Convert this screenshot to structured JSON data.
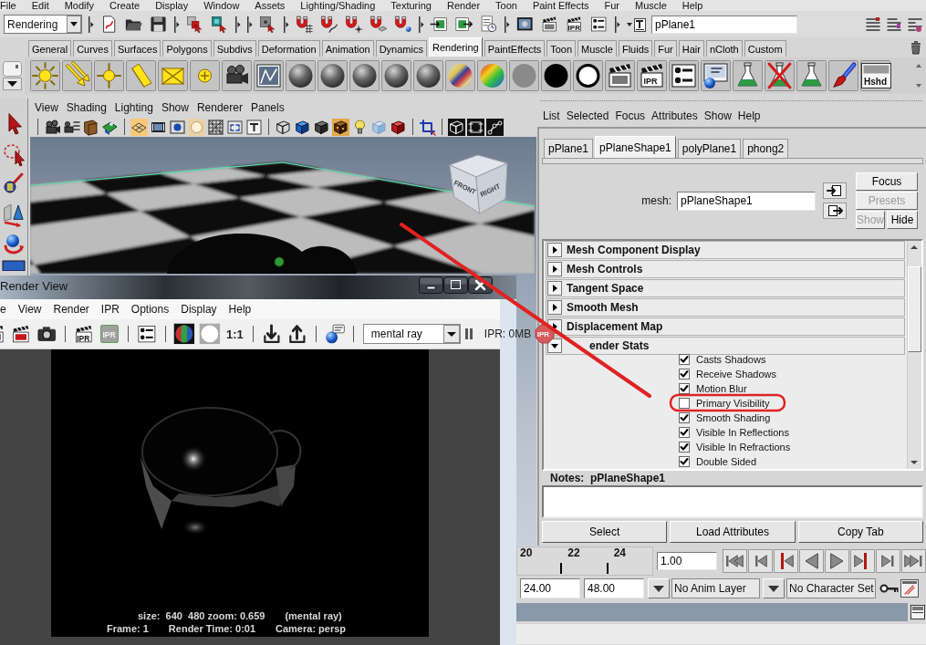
{
  "menu_bar": [
    "File",
    "Edit",
    "Modify",
    "Create",
    "Display",
    "Window",
    "Assets",
    "Lighting/Shading",
    "Texturing",
    "Render",
    "Toon",
    "Paint Effects",
    "Fur",
    "Muscle",
    "Help"
  ],
  "status_line": {
    "menu_set": "Rendering",
    "ipr_render_label": "IPR",
    "selection_field": "pPlane1"
  },
  "shelf": {
    "tabs": [
      {
        "label": "General",
        "selected": false
      },
      {
        "label": "Curves",
        "selected": false
      },
      {
        "label": "Surfaces",
        "selected": false
      },
      {
        "label": "Polygons",
        "selected": false
      },
      {
        "label": "Subdivs",
        "selected": false
      },
      {
        "label": "Deformation",
        "selected": false
      },
      {
        "label": "Animation",
        "selected": false
      },
      {
        "label": "Dynamics",
        "selected": false
      },
      {
        "label": "Rendering",
        "selected": true
      },
      {
        "label": "PaintEffects",
        "selected": false
      },
      {
        "label": "Toon",
        "selected": false
      },
      {
        "label": "Muscle",
        "selected": false
      },
      {
        "label": "Fluids",
        "selected": false
      },
      {
        "label": "Fur",
        "selected": false
      },
      {
        "label": "Hair",
        "selected": false
      },
      {
        "label": "nCloth",
        "selected": false
      },
      {
        "label": "Custom",
        "selected": false
      }
    ],
    "ipr_render_label": "IPR",
    "hypershade_label": "Hshd"
  },
  "viewport": {
    "menu": [
      "View",
      "Shading",
      "Lighting",
      "Show",
      "Renderer",
      "Panels"
    ],
    "view_cube_labels": [
      "FRONT",
      "RIGHT"
    ]
  },
  "attribute_editor": {
    "menu": [
      "List",
      "Selected",
      "Focus",
      "Attributes",
      "Show",
      "Help"
    ],
    "tabs": [
      {
        "label": "pPlane1",
        "selected": false
      },
      {
        "label": "pPlaneShape1",
        "selected": true
      },
      {
        "label": "polyPlane1",
        "selected": false
      },
      {
        "label": "phong2",
        "selected": false
      }
    ],
    "node_label": "mesh:",
    "node_name": "pPlaneShape1",
    "side_buttons": [
      {
        "label": "Focus",
        "disabled": false
      },
      {
        "label": "Presets",
        "disabled": true
      },
      {
        "label": "Show",
        "disabled": true
      },
      {
        "label": "Hide",
        "disabled": false
      }
    ],
    "sections": [
      {
        "title": "Mesh Component Display",
        "expanded": false
      },
      {
        "title": "Mesh Controls",
        "expanded": false
      },
      {
        "title": "Tangent Space",
        "expanded": false
      },
      {
        "title": "Smooth Mesh",
        "expanded": false
      },
      {
        "title": "Displacement Map",
        "expanded": false
      },
      {
        "title": "ender Stats",
        "expanded": true,
        "attributes": [
          {
            "label": "Casts Shadows",
            "checked": true
          },
          {
            "label": "Receive Shadows",
            "checked": true
          },
          {
            "label": "Motion Blur",
            "checked": true
          },
          {
            "label": "Primary Visibility",
            "checked": false
          },
          {
            "label": "Smooth Shading",
            "checked": true
          },
          {
            "label": "Visible In Reflections",
            "checked": true
          },
          {
            "label": "Visible In Refractions",
            "checked": true
          },
          {
            "label": "Double Sided",
            "checked": true
          }
        ]
      }
    ],
    "notes_title": "Notes:  pPlaneShape1",
    "footer_buttons": [
      "Select",
      "Load Attributes",
      "Copy Tab"
    ]
  },
  "time_slider": {
    "ticks": [
      "20",
      "22",
      "24"
    ],
    "current_time": "1.00"
  },
  "range_slider": {
    "start_time": "24.00",
    "end_time": "48.00",
    "anim_layer": "No Anim Layer",
    "character_set": "No Character Set"
  },
  "render_view": {
    "title": "Render View",
    "menu": [
      "e",
      "View",
      "Render",
      "IPR",
      "Options",
      "Display",
      "Help"
    ],
    "ipr_render_label": "IPR",
    "ipr_refresh_label": "IPR",
    "zoom_button": "1:1",
    "renderer": "mental ray",
    "ipr_memory": "IPR: 0MB",
    "ipr_stop_label": "IPR",
    "info_lines": [
      [
        "size:  640  480 zoom: 0.659",
        "(mental ray)"
      ],
      [
        "Frame: 1",
        "Render Time: 0:01",
        "Camera: persp"
      ]
    ]
  }
}
